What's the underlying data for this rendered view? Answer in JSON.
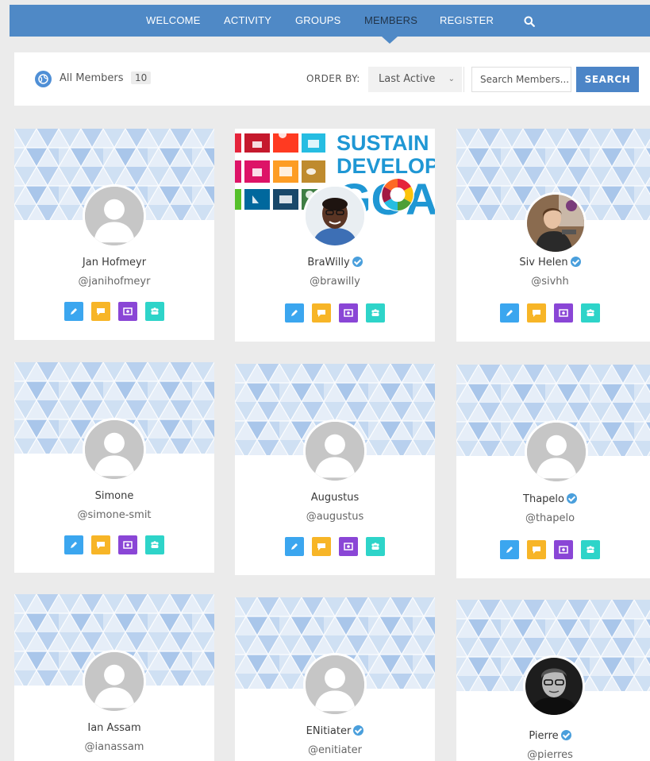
{
  "nav": {
    "items": [
      "WELCOME",
      "ACTIVITY",
      "GROUPS",
      "MEMBERS",
      "REGISTER"
    ],
    "active": "MEMBERS",
    "search_icon": "search-icon"
  },
  "filter": {
    "all_label": "All Members",
    "count": "10",
    "order_label": "ORDER BY:",
    "order_value": "Last Active",
    "search_placeholder": "Search Members...",
    "search_button": "SEARCH"
  },
  "members": [
    {
      "name": "Jan Hofmeyr",
      "handle": "@janihofmeyr",
      "verified": false,
      "avatar": "default"
    },
    {
      "name": "BraWilly",
      "handle": "@brawilly",
      "verified": true,
      "avatar": "photo"
    },
    {
      "name": "Siv Helen",
      "handle": "@sivhh",
      "verified": true,
      "avatar": "photo"
    },
    {
      "name": "Simone",
      "handle": "@simone-smit",
      "verified": false,
      "avatar": "default"
    },
    {
      "name": "Augustus",
      "handle": "@augustus",
      "verified": false,
      "avatar": "default"
    },
    {
      "name": "Thapelo",
      "handle": "@thapelo",
      "verified": true,
      "avatar": "default"
    },
    {
      "name": "Ian Assam",
      "handle": "@ianassam",
      "verified": false,
      "avatar": "default"
    },
    {
      "name": "ENitiater",
      "handle": "@enitiater",
      "verified": true,
      "avatar": "default"
    },
    {
      "name": "Pierre",
      "handle": "@pierres",
      "verified": true,
      "avatar": "photo"
    }
  ],
  "sdg_cover": {
    "line1": "SUSTAIN",
    "line2": "DEVELOP",
    "line3": "GOA"
  },
  "colors": {
    "nav": "#4f89c6",
    "search_button": "#4c85c7",
    "action_edit": "#3ba6ef",
    "action_message": "#f7b527",
    "action_profile": "#8a46d6",
    "action_group": "#2ed4c9",
    "verified": "#4a9fdc"
  }
}
